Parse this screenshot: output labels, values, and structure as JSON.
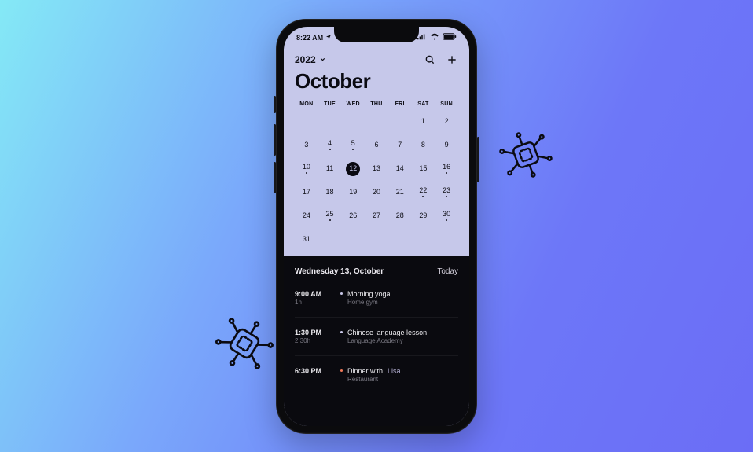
{
  "status": {
    "time": "8:22 AM",
    "loc_icon": "location-arrow",
    "signal": "cellular",
    "wifi": "wifi",
    "battery": "battery-full"
  },
  "header": {
    "year": "2022",
    "month": "October",
    "search_icon": "search",
    "add_icon": "plus"
  },
  "days_of_week": [
    "MON",
    "TUE",
    "WED",
    "THU",
    "FRI",
    "SAT",
    "SUN"
  ],
  "calendar": {
    "leading_blanks": 5,
    "days": [
      {
        "n": 1,
        "dot": false
      },
      {
        "n": 2,
        "dot": false
      },
      {
        "n": 3,
        "dot": false
      },
      {
        "n": 4,
        "dot": true
      },
      {
        "n": 5,
        "dot": true
      },
      {
        "n": 6,
        "dot": false
      },
      {
        "n": 7,
        "dot": false
      },
      {
        "n": 8,
        "dot": false
      },
      {
        "n": 9,
        "dot": false
      },
      {
        "n": 10,
        "dot": true
      },
      {
        "n": 11,
        "dot": false
      },
      {
        "n": 12,
        "dot": false,
        "selected": true
      },
      {
        "n": 13,
        "dot": false
      },
      {
        "n": 14,
        "dot": false
      },
      {
        "n": 15,
        "dot": false
      },
      {
        "n": 16,
        "dot": true
      },
      {
        "n": 17,
        "dot": false
      },
      {
        "n": 18,
        "dot": false
      },
      {
        "n": 19,
        "dot": false
      },
      {
        "n": 20,
        "dot": false
      },
      {
        "n": 21,
        "dot": false
      },
      {
        "n": 22,
        "dot": true
      },
      {
        "n": 23,
        "dot": true
      },
      {
        "n": 24,
        "dot": false
      },
      {
        "n": 25,
        "dot": true
      },
      {
        "n": 26,
        "dot": false
      },
      {
        "n": 27,
        "dot": false
      },
      {
        "n": 28,
        "dot": false
      },
      {
        "n": 29,
        "dot": false
      },
      {
        "n": 30,
        "dot": true
      },
      {
        "n": 31,
        "dot": false
      }
    ]
  },
  "detail": {
    "date_label": "Wednesday 13, October",
    "today_label": "Today",
    "events": [
      {
        "time": "9:00 AM",
        "dur": "1h",
        "title": "Morning yoga",
        "location": "Home gym",
        "accent": "a"
      },
      {
        "time": "1:30 PM",
        "dur": "2.30h",
        "title": "Chinese language lesson",
        "location": "Language Academy",
        "accent": "a"
      },
      {
        "time": "6:30 PM",
        "dur": "",
        "title_prefix": "Dinner with ",
        "title_link": "Lisa",
        "location": "Restaurant",
        "accent": "b"
      }
    ]
  }
}
